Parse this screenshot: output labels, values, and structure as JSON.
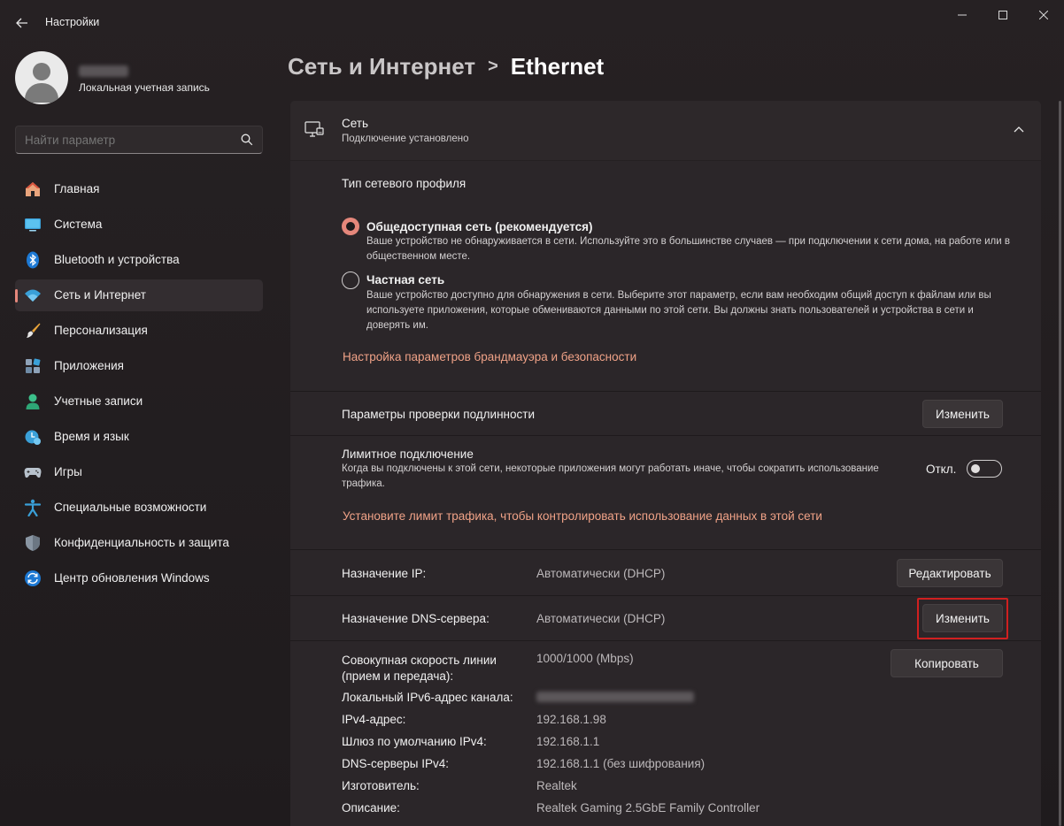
{
  "window": {
    "app_title": "Настройки",
    "controls": [
      "minimize",
      "maximize",
      "close"
    ]
  },
  "user": {
    "account_type": "Локальная учетная запись"
  },
  "search": {
    "placeholder": "Найти параметр"
  },
  "sidebar": {
    "items": [
      {
        "label": "Главная",
        "icon": "home-icon",
        "active": false
      },
      {
        "label": "Система",
        "icon": "system-icon",
        "active": false
      },
      {
        "label": "Bluetooth и устройства",
        "icon": "bluetooth-icon",
        "active": false
      },
      {
        "label": "Сеть и Интернет",
        "icon": "wifi-icon",
        "active": true
      },
      {
        "label": "Персонализация",
        "icon": "brush-icon",
        "active": false
      },
      {
        "label": "Приложения",
        "icon": "apps-icon",
        "active": false
      },
      {
        "label": "Учетные записи",
        "icon": "accounts-icon",
        "active": false
      },
      {
        "label": "Время и язык",
        "icon": "time-language-icon",
        "active": false
      },
      {
        "label": "Игры",
        "icon": "gamepad-icon",
        "active": false
      },
      {
        "label": "Специальные возможности",
        "icon": "accessibility-icon",
        "active": false
      },
      {
        "label": "Конфиденциальность и защита",
        "icon": "shield-icon",
        "active": false
      },
      {
        "label": "Центр обновления Windows",
        "icon": "update-icon",
        "active": false
      }
    ]
  },
  "breadcrumb": {
    "parent": "Сеть и Интернет",
    "separator": ">",
    "current": "Ethernet"
  },
  "network": {
    "title": "Сеть",
    "status": "Подключение установлено"
  },
  "profile": {
    "heading": "Тип сетевого профиля",
    "public": {
      "label": "Общедоступная сеть (рекомендуется)",
      "desc": "Ваше устройство не обнаруживается в сети. Используйте это в большинстве случаев — при подключении к сети дома, на работе или в общественном месте.",
      "selected": true
    },
    "private": {
      "label": "Частная сеть",
      "desc": "Ваше устройство доступно для обнаружения в сети. Выберите этот параметр, если вам необходим общий доступ к файлам или вы используете приложения, которые обмениваются данными по этой сети. Вы должны знать пользователей и устройства в сети и доверять им.",
      "selected": false
    },
    "firewall_link": "Настройка параметров брандмауэра и безопасности"
  },
  "auth": {
    "label": "Параметры проверки подлинности",
    "button": "Изменить"
  },
  "metered": {
    "label": "Лимитное подключение",
    "desc": "Когда вы подключены к этой сети, некоторые приложения могут работать иначе, чтобы сократить использование трафика.",
    "state": "Откл.",
    "link": "Установите лимит трафика, чтобы контролировать использование данных в этой сети"
  },
  "ip": {
    "label": "Назначение IP:",
    "value": "Автоматически (DHCP)",
    "button": "Редактировать"
  },
  "dns": {
    "label": "Назначение DNS-сервера:",
    "value": "Автоматически (DHCP)",
    "button": "Изменить"
  },
  "details": {
    "copy_button": "Копировать",
    "rows": [
      {
        "label": "Совокупная скорость линии\n(прием и передача):",
        "value": "1000/1000 (Mbps)"
      },
      {
        "label": "Локальный IPv6-адрес канала:",
        "value": ""
      },
      {
        "label": "IPv4-адрес:",
        "value": "192.168.1.98"
      },
      {
        "label": "Шлюз по умолчанию IPv4:",
        "value": "192.168.1.1"
      },
      {
        "label": "DNS-серверы IPv4:",
        "value": "192.168.1.1 (без шифрования)"
      },
      {
        "label": "Изготовитель:",
        "value": "Realtek"
      },
      {
        "label": "Описание:",
        "value": "Realtek Gaming 2.5GbE Family Controller"
      }
    ]
  },
  "colors": {
    "accent": "#e5877b",
    "link": "#f0a287",
    "highlight_box": "#d02020"
  }
}
